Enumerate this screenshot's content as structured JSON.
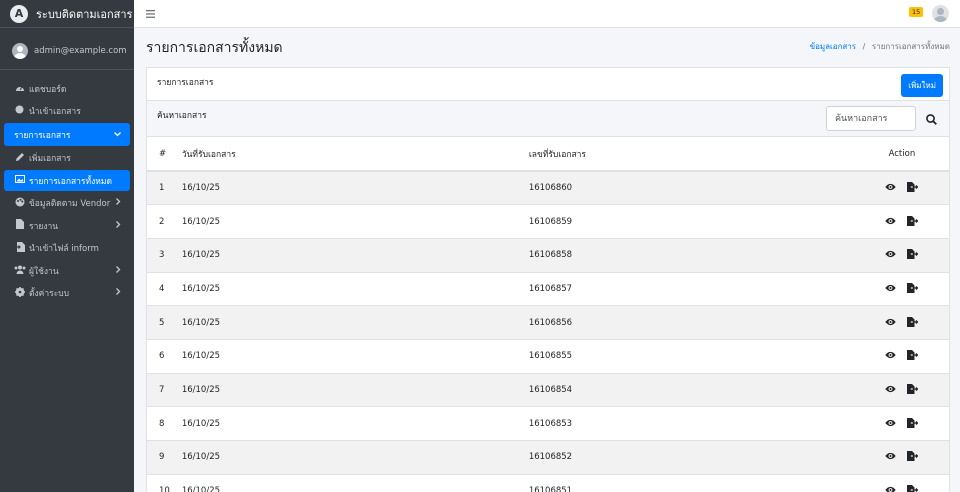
{
  "brand": {
    "title": "ระบบติดตามเอกสาร"
  },
  "user": {
    "email": "admin@example.com"
  },
  "sidebar": {
    "items": [
      {
        "label": "แดชบอร์ด",
        "icon": "dashboard-icon"
      },
      {
        "label": "นำเข้าเอกสาร",
        "icon": "circle-icon"
      },
      {
        "label": "รายการเอกสาร",
        "icon": "",
        "expanded": true
      },
      {
        "label": "เพิ่มเอกสาร",
        "icon": "pencil-icon"
      },
      {
        "label": "รายการเอกสารทั้งหมด",
        "icon": "image-icon"
      },
      {
        "label": "ข้อมูลติดตาม Vendor",
        "icon": "palette-icon"
      },
      {
        "label": "รายงาน",
        "icon": "file-icon"
      },
      {
        "label": "นำเข้าไฟล์ inform",
        "icon": "file-import-icon"
      },
      {
        "label": "ผู้ใช้งาน",
        "icon": "users-icon"
      },
      {
        "label": "ตั้งค่าระบบ",
        "icon": "cog-icon"
      }
    ]
  },
  "topbar": {
    "badge": "15"
  },
  "page": {
    "title": "รายการเอกสารทั้งหมด"
  },
  "breadcrumb": {
    "link": "ข้อมูลเอกสาร",
    "separator": "/",
    "current": "รายการเอกสารทั้งหมด"
  },
  "card": {
    "title": "รายการเอกสาร",
    "add_button": "เพิ่มใหม่"
  },
  "search": {
    "label": "ค้นหาเอกสาร",
    "placeholder": "ค้นหาเอกสาร"
  },
  "table": {
    "headers": [
      "#",
      "วันที่รับเอกสาร",
      "เลขที่รับเอกสาร",
      "Action"
    ],
    "rows": [
      {
        "num": "1",
        "date": "16/10/25",
        "docno": "16106860"
      },
      {
        "num": "2",
        "date": "16/10/25",
        "docno": "16106859"
      },
      {
        "num": "3",
        "date": "16/10/25",
        "docno": "16106858"
      },
      {
        "num": "4",
        "date": "16/10/25",
        "docno": "16106857"
      },
      {
        "num": "5",
        "date": "16/10/25",
        "docno": "16106856"
      },
      {
        "num": "6",
        "date": "16/10/25",
        "docno": "16106855"
      },
      {
        "num": "7",
        "date": "16/10/25",
        "docno": "16106854"
      },
      {
        "num": "8",
        "date": "16/10/25",
        "docno": "16106853"
      },
      {
        "num": "9",
        "date": "16/10/25",
        "docno": "16106852"
      },
      {
        "num": "10",
        "date": "16/10/25",
        "docno": "16106851"
      }
    ]
  },
  "colors": {
    "primary": "#007bff",
    "sidebar": "#343a40",
    "badge": "#ffc107"
  }
}
